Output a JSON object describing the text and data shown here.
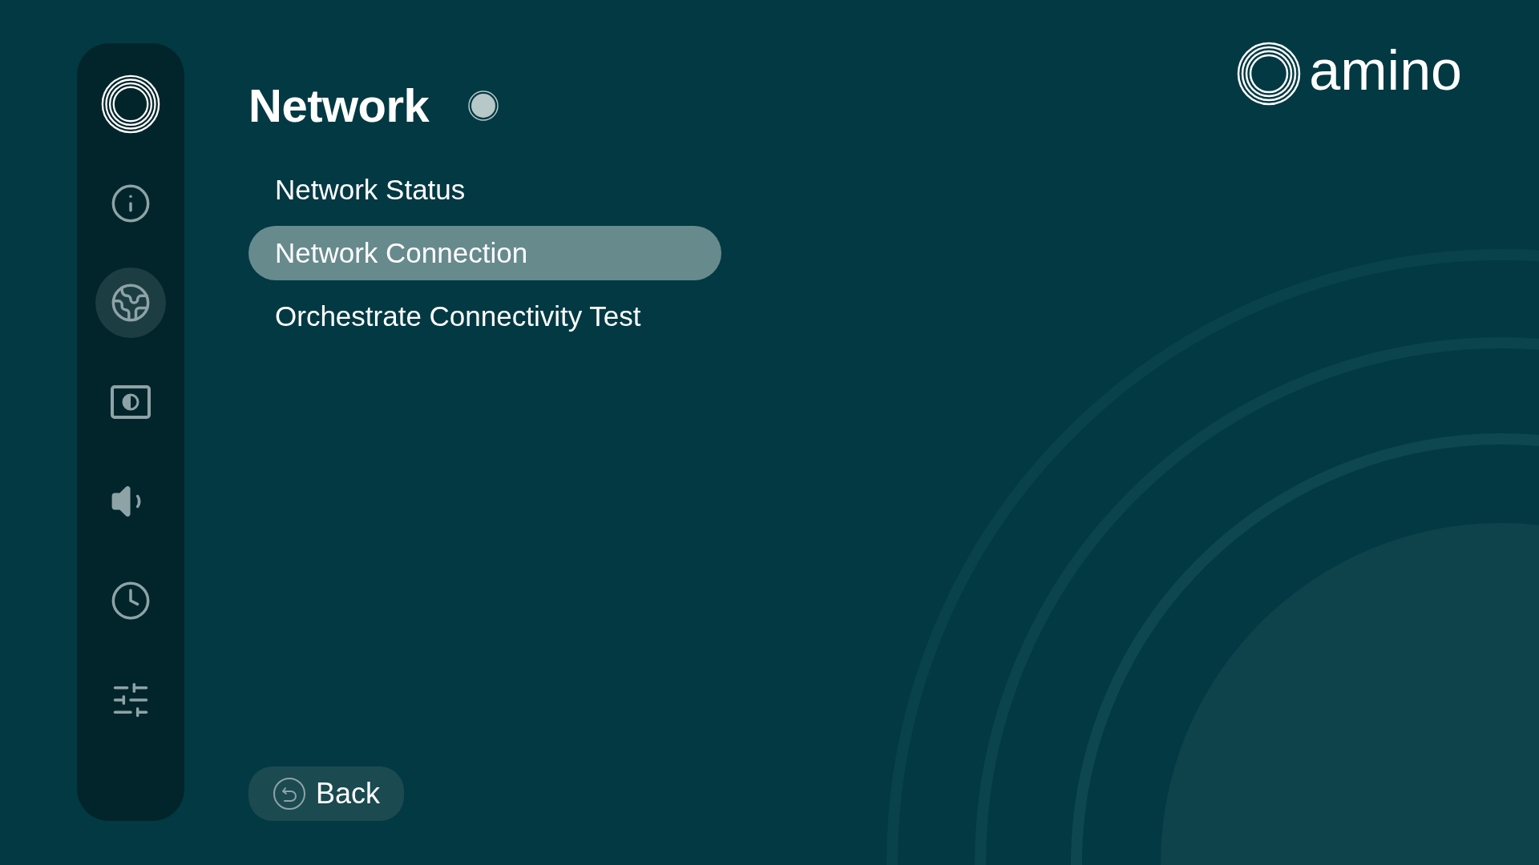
{
  "sidebar": {
    "items": [
      {
        "kind": "home",
        "selected": false
      },
      {
        "kind": "info",
        "selected": false
      },
      {
        "kind": "network",
        "selected": true
      },
      {
        "kind": "display",
        "selected": false
      },
      {
        "kind": "sound",
        "selected": false
      },
      {
        "kind": "time",
        "selected": false
      },
      {
        "kind": "settings",
        "selected": false
      }
    ]
  },
  "title": "Network",
  "menu": [
    {
      "label": "Network Status",
      "selected": false
    },
    {
      "label": "Network Connection",
      "selected": true
    },
    {
      "label": "Orchestrate Connectivity Test",
      "selected": false
    }
  ],
  "back_button": {
    "label": "Back"
  },
  "logo": {
    "text": "amino"
  }
}
